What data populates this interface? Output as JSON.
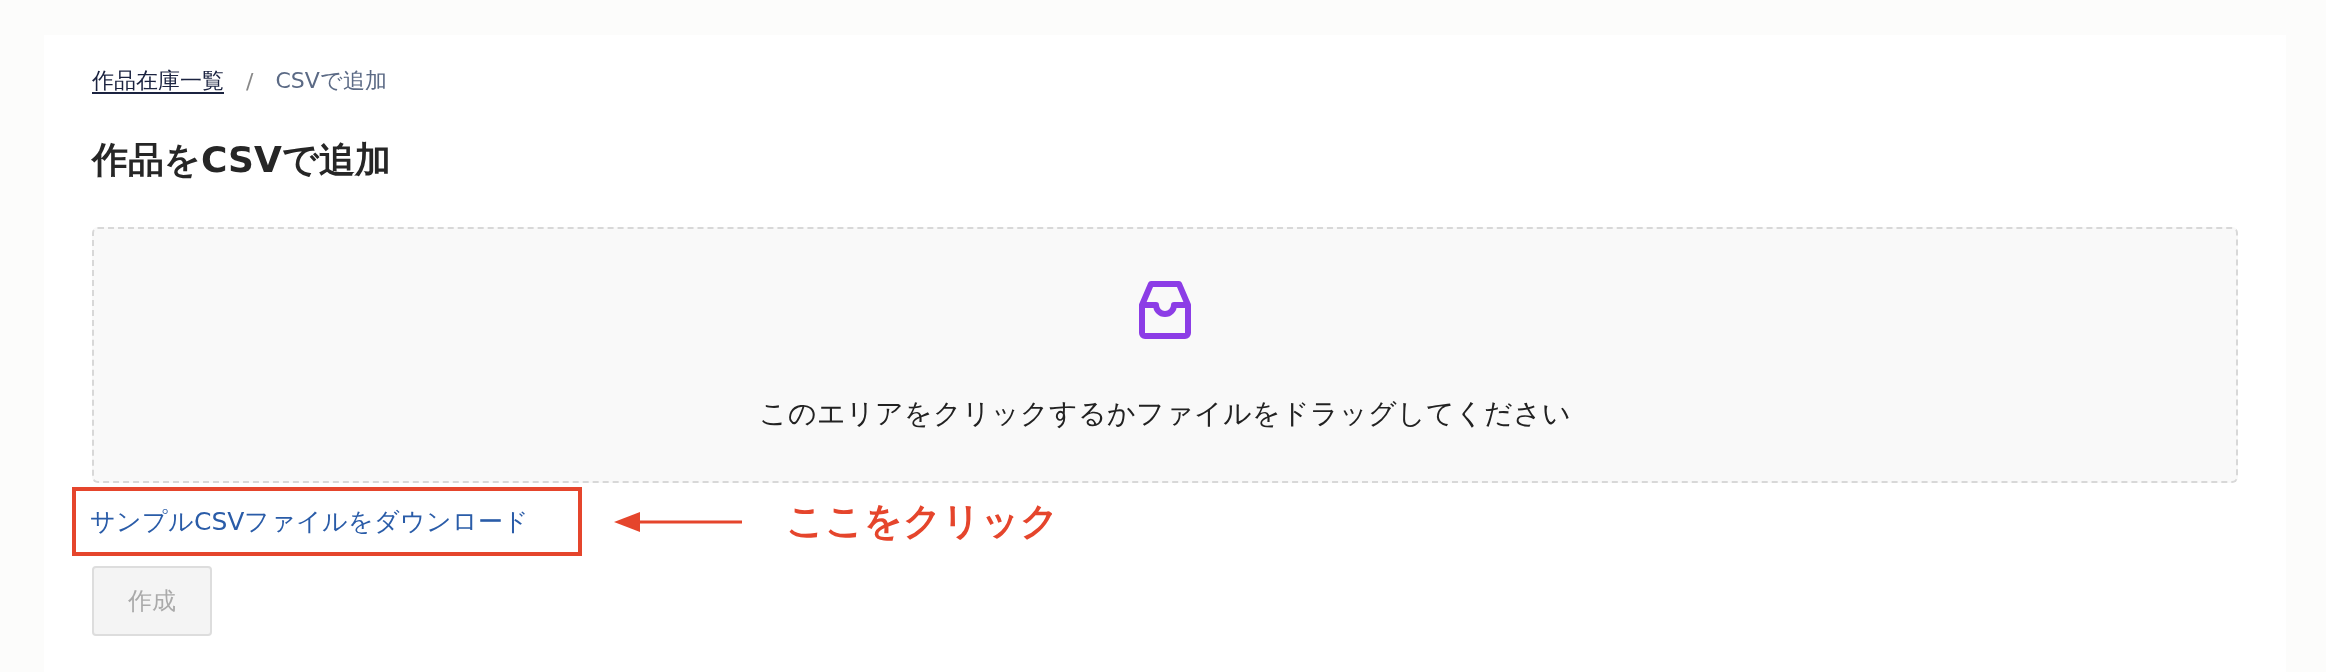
{
  "breadcrumb": [
    {
      "label": "作品在庫一覧",
      "link": true
    },
    {
      "label": "/",
      "kind": "separator"
    },
    {
      "label": "CSVで追加",
      "link": false
    }
  ],
  "title": "作品をCSVで追加",
  "dropzone": {
    "text": "このエリアをクリックするかファイルをドラッグしてください"
  },
  "sample_link": {
    "label": "サンプルCSVファイルをダウンロード"
  },
  "annotation": {
    "label": "ここをクリック"
  },
  "submit_button": {
    "label": "作成",
    "disabled": true
  }
}
